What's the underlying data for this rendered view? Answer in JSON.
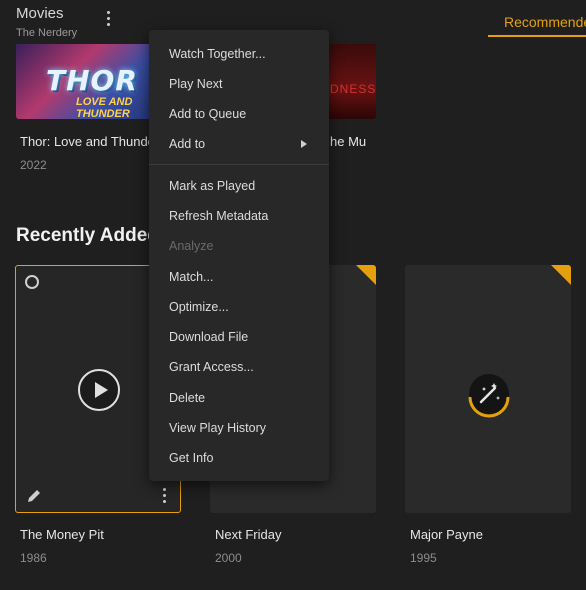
{
  "header": {
    "library_title": "Movies",
    "library_server": "The Nerdery",
    "active_tab": "Recommended"
  },
  "top_row": {
    "items": [
      {
        "title": "Thor: Love and Thunder",
        "year": "2022",
        "logo_line1": "THOR",
        "logo_line2": "LOVE AND THUNDER"
      },
      {
        "title": "Doctor Strange in the Multiverse of Madness",
        "visible_title": "he Mu",
        "poster_text": "DNESS"
      }
    ]
  },
  "recently_added": {
    "heading": "Recently Added",
    "items": [
      {
        "title": "The Money Pit",
        "year": "1986"
      },
      {
        "title": "Next Friday",
        "year": "2000"
      },
      {
        "title": "Major Payne",
        "year": "1995"
      }
    ]
  },
  "context_menu": {
    "items": [
      {
        "label": "Watch Together...",
        "disabled": false
      },
      {
        "label": "Play Next",
        "disabled": false
      },
      {
        "label": "Add to Queue",
        "disabled": false
      },
      {
        "label": "Add to",
        "disabled": false,
        "submenu": true
      },
      {
        "label": "Mark as Played",
        "disabled": false
      },
      {
        "label": "Refresh Metadata",
        "disabled": false
      },
      {
        "label": "Analyze",
        "disabled": true
      },
      {
        "label": "Match...",
        "disabled": false
      },
      {
        "label": "Optimize...",
        "disabled": false
      },
      {
        "label": "Download File",
        "disabled": false
      },
      {
        "label": "Grant Access...",
        "disabled": false
      },
      {
        "label": "Delete",
        "disabled": false
      },
      {
        "label": "View Play History",
        "disabled": false
      },
      {
        "label": "Get Info",
        "disabled": false
      }
    ]
  },
  "colors": {
    "accent": "#e5a00d",
    "background": "#1f1f1f",
    "menu_bg": "#282828"
  }
}
